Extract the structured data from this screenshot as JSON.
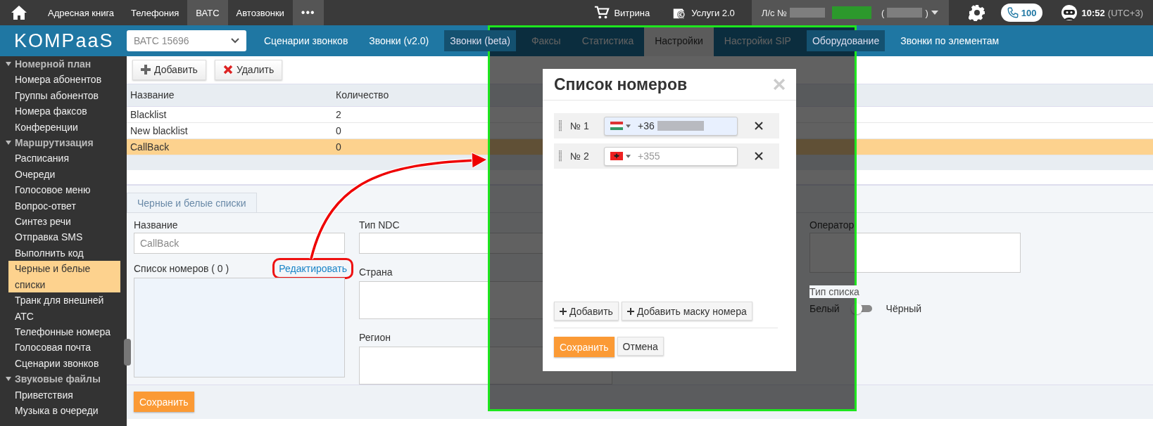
{
  "top_bar": {
    "items": [
      {
        "label": "Адресная книга",
        "selected": false
      },
      {
        "label": "Телефония",
        "selected": false
      },
      {
        "label": "ВАТС",
        "selected": true
      },
      {
        "label": "Автозвонки",
        "selected": false
      }
    ],
    "more": "•••",
    "shop": "Витрина",
    "services": "Услуги 2.0",
    "account": {
      "prefix": "Л/с №",
      "open_paren": "(",
      "close_paren": ")"
    },
    "calls_badge": "100",
    "time": "10:52",
    "timezone": "(UTC+3)"
  },
  "header": {
    "logo": "KOMPaaS",
    "pbx_select": "ВАТС 15696",
    "nav": [
      {
        "label": "Сценарии звонков",
        "selected": false
      },
      {
        "label": "Звонки (v2.0)",
        "selected": false
      },
      {
        "label": "Звонки (beta)",
        "selected": false
      },
      {
        "label": "Факсы",
        "selected": false
      },
      {
        "label": "Статистика",
        "selected": false
      },
      {
        "label": "Настройки",
        "selected": true
      },
      {
        "label": "Настройки SIP",
        "selected": false
      },
      {
        "label": "Оборудование",
        "selected": false
      },
      {
        "label": "Звонки по элементам",
        "selected": false
      }
    ]
  },
  "sidebar": {
    "groups": [
      {
        "title": "Номерной план",
        "expanded": true,
        "items": [
          {
            "label": "Номера абонентов",
            "selected": false
          },
          {
            "label": "Группы абонентов",
            "selected": false
          },
          {
            "label": "Номера факсов",
            "selected": false
          },
          {
            "label": "Конференции",
            "selected": false
          }
        ]
      },
      {
        "title": "Маршрутизация",
        "expanded": true,
        "items": [
          {
            "label": "Расписания",
            "selected": false
          },
          {
            "label": "Очереди",
            "selected": false
          },
          {
            "label": "Голосовое меню",
            "selected": false
          },
          {
            "label": "Вопрос-ответ",
            "selected": false
          },
          {
            "label": "Синтез речи",
            "selected": false
          },
          {
            "label": "Отправка SMS",
            "selected": false
          },
          {
            "label": "Выполнить код",
            "selected": false
          },
          {
            "label": "Черные и белые списки",
            "selected": true
          },
          {
            "label": "Транк для внешней АТС",
            "selected": false
          },
          {
            "label": "Телефонные номера",
            "selected": false
          },
          {
            "label": "Голосовая почта",
            "selected": false
          },
          {
            "label": "Сценарии звонков",
            "selected": false
          }
        ]
      },
      {
        "title": "Звуковые файлы",
        "expanded": true,
        "items": [
          {
            "label": "Приветствия",
            "selected": false
          },
          {
            "label": "Музыка в очереди",
            "selected": false
          }
        ]
      }
    ]
  },
  "toolbar": {
    "buttons": [
      {
        "label": "Добавить",
        "kind": "add"
      },
      {
        "label": "Удалить",
        "kind": "delete"
      }
    ]
  },
  "table": {
    "columns": [
      "Название",
      "Количество"
    ],
    "rows": [
      {
        "cells": [
          "Blacklist",
          "2"
        ],
        "selected": false
      },
      {
        "cells": [
          "New blacklist",
          "0"
        ],
        "selected": false
      },
      {
        "cells": [
          "CallBack",
          "0"
        ],
        "selected": true
      }
    ]
  },
  "form": {
    "tab": "Черные и белые списки",
    "name_label": "Название",
    "name_value": "CallBack",
    "numbers_label": "Список номеров ( 0 )",
    "edit_link": "Редактировать",
    "ndc_label": "Тип NDC",
    "country_label": "Страна",
    "region_label": "Регион",
    "operator_label": "Оператор",
    "list_type_label": "Тип списка",
    "white_label": "Белый",
    "black_label": "Чёрный",
    "black": false,
    "save_button": "Сохранить"
  },
  "modal": {
    "title": "Список номеров",
    "rows": [
      {
        "label": "№ 1",
        "kind": "hu",
        "value": "+36",
        "focused": true
      },
      {
        "label": "№ 2",
        "kind": "al",
        "placeholder": "+355",
        "focused": false
      }
    ],
    "add_button": "Добавить",
    "add_mask_button": "Добавить маску номера",
    "save_button": "Сохранить",
    "cancel_button": "Отмена"
  }
}
